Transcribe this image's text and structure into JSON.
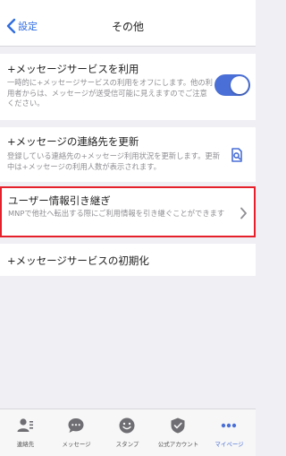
{
  "nav": {
    "back_label": "設定",
    "title": "その他"
  },
  "plus_service": {
    "title": "+メッセージサービスを利用",
    "description": "一時的に+メッセージサービスの利用をオフにします。他の利用者からは、メッセージが送受信可能に見えますのでご注意ください。",
    "toggle_on": true
  },
  "contacts_update": {
    "title": "+メッセージの連絡先を更新",
    "description": "登録している連絡先の+メッセージ利用状況を更新します。更新中は+メッセージの利用人数が表示されます。",
    "icon": "search-document-icon"
  },
  "user_transfer": {
    "title": "ユーザー情報引き継ぎ",
    "description": "MNPで他社へ転出する際にご利用情報を引き継ぐことができます"
  },
  "reset": {
    "title": "+メッセージサービスの初期化"
  },
  "tabs": [
    {
      "label": "連絡先",
      "icon": "contacts-icon"
    },
    {
      "label": "メッセージ",
      "icon": "message-icon"
    },
    {
      "label": "スタンプ",
      "icon": "stamp-icon"
    },
    {
      "label": "公式アカウント",
      "icon": "official-account-icon"
    },
    {
      "label": "マイページ",
      "icon": "mypage-icon",
      "active": true
    }
  ],
  "colors": {
    "accent": "#4a6fd6",
    "highlight_border": "#e5202a",
    "background": "#efeff4"
  }
}
